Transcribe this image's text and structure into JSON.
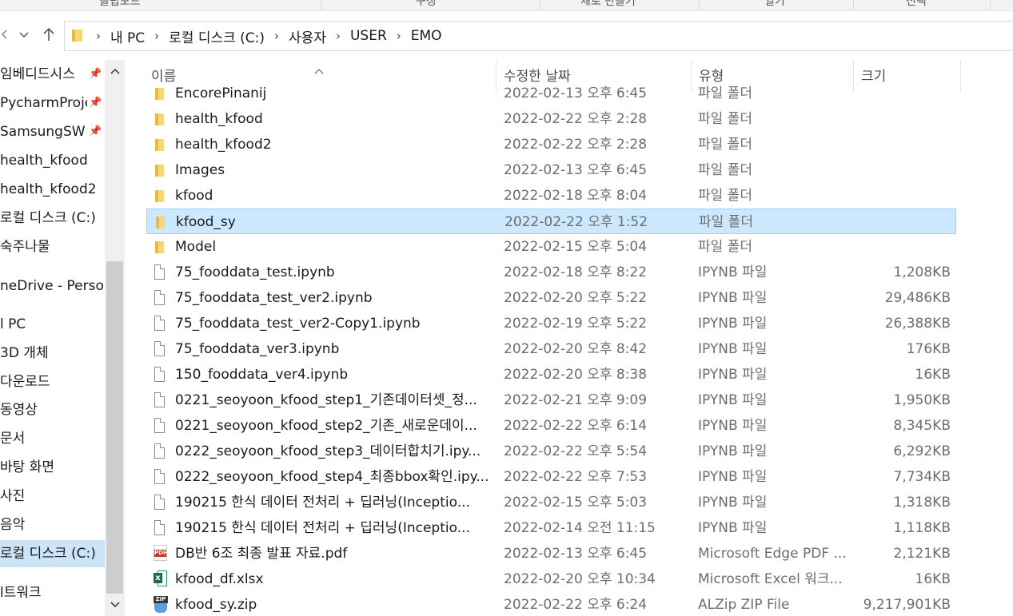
{
  "ribbon": {
    "groups": [
      "클립보드",
      "구성",
      "새로 만들기",
      "열기",
      "선택"
    ]
  },
  "nav": {
    "back_icon": "chevron-left-icon",
    "recent_icon": "chevron-down-icon",
    "up_icon": "arrow-up-icon",
    "breadcrumbs": [
      "내 PC",
      "로컬 디스크 (C:)",
      "사용자",
      "USER",
      "EMO"
    ]
  },
  "sidebar": {
    "items": [
      {
        "label": "임베디드시스",
        "pinned": true
      },
      {
        "label": "PycharmProje",
        "pinned": true
      },
      {
        "label": "SamsungSW",
        "pinned": true
      },
      {
        "label": "health_kfood",
        "pinned": false
      },
      {
        "label": "health_kfood2",
        "pinned": false
      },
      {
        "label": "로컬 디스크 (C:)",
        "pinned": false
      },
      {
        "label": "숙주나물",
        "pinned": false
      },
      {
        "label": "neDrive - Person",
        "pinned": false
      },
      {
        "label": "l PC",
        "pinned": false
      },
      {
        "label": "3D 개체",
        "pinned": false
      },
      {
        "label": "다운로드",
        "pinned": false
      },
      {
        "label": "동영상",
        "pinned": false
      },
      {
        "label": "문서",
        "pinned": false
      },
      {
        "label": "바탕 화면",
        "pinned": false
      },
      {
        "label": "사진",
        "pinned": false
      },
      {
        "label": "음악",
        "pinned": false
      },
      {
        "label": "로컬 디스크 (C:)",
        "pinned": false,
        "selected": true
      },
      {
        "label": "l트워크",
        "pinned": false
      }
    ],
    "pin_glyph": "📌"
  },
  "columns": {
    "name": "이름",
    "date": "수정한 날짜",
    "type": "유형",
    "size": "크기"
  },
  "files": [
    {
      "name": "EncorePinanij",
      "date": "2022-02-13 오후 6:45",
      "type": "파일 폴더",
      "size": "",
      "kind": "folder"
    },
    {
      "name": "health_kfood",
      "date": "2022-02-22 오후 2:28",
      "type": "파일 폴더",
      "size": "",
      "kind": "folder"
    },
    {
      "name": "health_kfood2",
      "date": "2022-02-22 오후 2:28",
      "type": "파일 폴더",
      "size": "",
      "kind": "folder"
    },
    {
      "name": "Images",
      "date": "2022-02-13 오후 6:45",
      "type": "파일 폴더",
      "size": "",
      "kind": "folder"
    },
    {
      "name": "kfood",
      "date": "2022-02-18 오후 8:04",
      "type": "파일 폴더",
      "size": "",
      "kind": "folder"
    },
    {
      "name": "kfood_sy",
      "date": "2022-02-22 오후 1:52",
      "type": "파일 폴더",
      "size": "",
      "kind": "folder",
      "selected": true
    },
    {
      "name": "Model",
      "date": "2022-02-15 오후 5:04",
      "type": "파일 폴더",
      "size": "",
      "kind": "folder"
    },
    {
      "name": "75_fooddata_test.ipynb",
      "date": "2022-02-18 오후 8:22",
      "type": "IPYNB 파일",
      "size": "1,208KB",
      "kind": "file"
    },
    {
      "name": "75_fooddata_test_ver2.ipynb",
      "date": "2022-02-20 오후 5:22",
      "type": "IPYNB 파일",
      "size": "29,486KB",
      "kind": "file"
    },
    {
      "name": "75_fooddata_test_ver2-Copy1.ipynb",
      "date": "2022-02-19 오후 5:22",
      "type": "IPYNB 파일",
      "size": "26,388KB",
      "kind": "file"
    },
    {
      "name": "75_fooddata_ver3.ipynb",
      "date": "2022-02-20 오후 8:42",
      "type": "IPYNB 파일",
      "size": "176KB",
      "kind": "file"
    },
    {
      "name": "150_fooddata_ver4.ipynb",
      "date": "2022-02-20 오후 8:38",
      "type": "IPYNB 파일",
      "size": "16KB",
      "kind": "file"
    },
    {
      "name": "0221_seoyoon_kfood_step1_기존데이터셋_정...",
      "date": "2022-02-21 오후 9:09",
      "type": "IPYNB 파일",
      "size": "1,950KB",
      "kind": "file"
    },
    {
      "name": "0221_seoyoon_kfood_step2_기존_새로운데이...",
      "date": "2022-02-22 오후 6:14",
      "type": "IPYNB 파일",
      "size": "8,345KB",
      "kind": "file"
    },
    {
      "name": "0222_seoyoon_kfood_step3_데이터합치기.ipy...",
      "date": "2022-02-22 오후 5:54",
      "type": "IPYNB 파일",
      "size": "6,292KB",
      "kind": "file"
    },
    {
      "name": "0222_seoyoon_kfood_step4_최종bbox확인.ipy...",
      "date": "2022-02-22 오후 7:53",
      "type": "IPYNB 파일",
      "size": "7,734KB",
      "kind": "file"
    },
    {
      "name": "190215 한식 데이터 전처리 + 딥러닝(Inceptio...",
      "date": "2022-02-15 오후 5:03",
      "type": "IPYNB 파일",
      "size": "1,318KB",
      "kind": "file"
    },
    {
      "name": "190215 한식 데이터 전처리 + 딥러닝(Inceptio...",
      "date": "2022-02-14 오전 11:15",
      "type": "IPYNB 파일",
      "size": "1,118KB",
      "kind": "file"
    },
    {
      "name": "DB반 6조 최종 발표 자료.pdf",
      "date": "2022-02-13 오후 6:45",
      "type": "Microsoft Edge PDF ...",
      "size": "2,121KB",
      "kind": "pdf"
    },
    {
      "name": "kfood_df.xlsx",
      "date": "2022-02-20 오후 10:34",
      "type": "Microsoft Excel 워크...",
      "size": "16KB",
      "kind": "xlsx"
    },
    {
      "name": "kfood_sy.zip",
      "date": "2022-02-22 오후 6:24",
      "type": "ALZip ZIP File",
      "size": "9,217,901KB",
      "kind": "zip"
    }
  ]
}
